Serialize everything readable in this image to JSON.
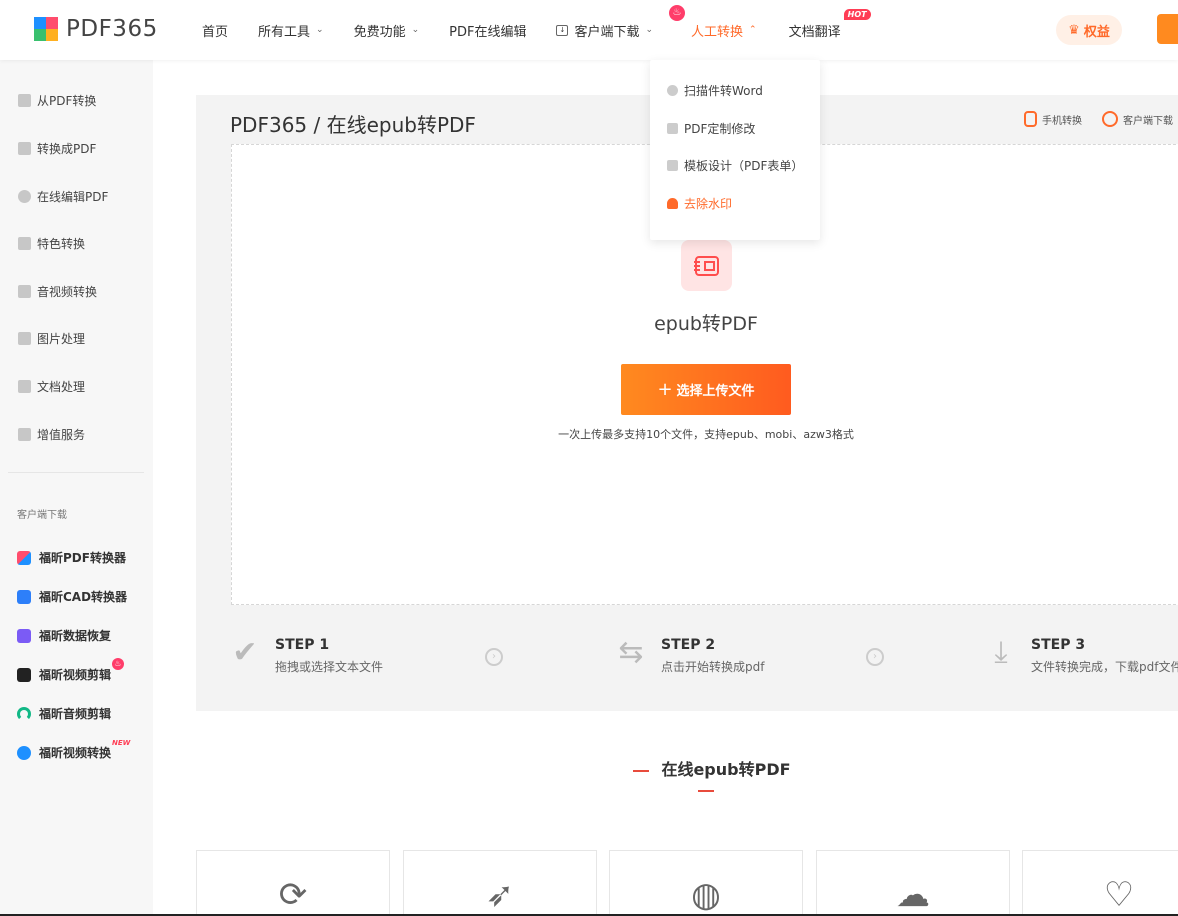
{
  "header": {
    "logo_text": "PDF365",
    "nav": [
      {
        "label": "首页"
      },
      {
        "label": "所有工具"
      },
      {
        "label": "免费功能"
      },
      {
        "label": "PDF在线编辑"
      },
      {
        "label": "客户端下载"
      },
      {
        "label": "人工转换"
      },
      {
        "label": "文档翻译",
        "badge": "HOT"
      }
    ],
    "benefits_label": "权益"
  },
  "sidebar": {
    "items": [
      {
        "label": "从PDF转换"
      },
      {
        "label": "转换成PDF"
      },
      {
        "label": "在线编辑PDF"
      },
      {
        "label": "特色转换"
      },
      {
        "label": "音视频转换"
      },
      {
        "label": "图片处理"
      },
      {
        "label": "文档处理"
      },
      {
        "label": "增值服务"
      }
    ],
    "downloads_caption": "客户端下载",
    "apps": [
      {
        "label": "福昕PDF转换器"
      },
      {
        "label": "福昕CAD转换器"
      },
      {
        "label": "福昕数据恢复"
      },
      {
        "label": "福昕视频剪辑"
      },
      {
        "label": "福昕音频剪辑"
      },
      {
        "label": "福昕视频转换",
        "badge": "NEW"
      }
    ]
  },
  "dropdown": {
    "items": [
      {
        "label": "扫描件转Word"
      },
      {
        "label": "PDF定制修改"
      },
      {
        "label": "模板设计（PDF表单）"
      },
      {
        "label": "去除水印"
      }
    ]
  },
  "main": {
    "breadcrumb": "PDF365 / 在线epub转PDF",
    "links": {
      "mobile": "手机转换",
      "client": "客户端下载"
    },
    "file_label": "epub转PDF",
    "upload_button": "选择上传文件",
    "upload_hint": "一次上传最多支持10个文件，支持epub、mobi、azw3格式",
    "steps": [
      {
        "title": "STEP 1",
        "desc": "拖拽或选择文本文件"
      },
      {
        "title": "STEP 2",
        "desc": "点击开始转换成pdf"
      },
      {
        "title": "STEP 3",
        "desc": "文件转换完成，下载pdf文件"
      }
    ],
    "section_title": "在线epub转PDF"
  },
  "colors": {
    "accent": "#ff6a2a",
    "panel": "#f3f3f3",
    "sidebar": "#f7f7f7"
  }
}
